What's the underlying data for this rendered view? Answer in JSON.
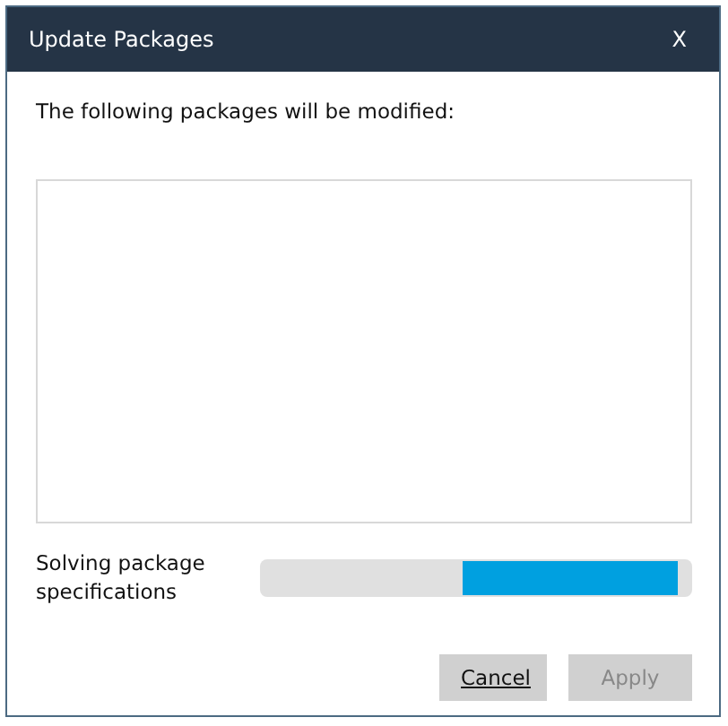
{
  "window": {
    "title": "Update Packages",
    "close": "X"
  },
  "message": "The following packages will be modified:",
  "progress": {
    "label": "Solving package specifications"
  },
  "buttons": [
    {
      "label": "Cancel",
      "disabled": false
    },
    {
      "label": "Apply",
      "disabled": true
    }
  ]
}
